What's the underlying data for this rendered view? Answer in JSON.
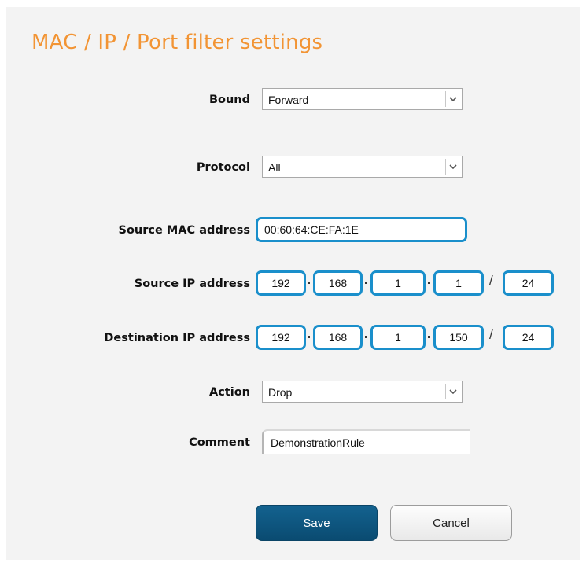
{
  "page": {
    "title": "MAC / IP / Port filter settings"
  },
  "form": {
    "bound": {
      "label": "Bound",
      "value": "Forward"
    },
    "protocol": {
      "label": "Protocol",
      "value": "All"
    },
    "source_mac": {
      "label": "Source MAC address",
      "value": "00:60:64:CE:FA:1E"
    },
    "source_ip": {
      "label": "Source IP address",
      "octets": [
        "192",
        "168",
        "1",
        "1"
      ],
      "mask": "24"
    },
    "destination_ip": {
      "label": "Destination IP address",
      "octets": [
        "192",
        "168",
        "1",
        "150"
      ],
      "mask": "24"
    },
    "action": {
      "label": "Action",
      "value": "Drop"
    },
    "comment": {
      "label": "Comment",
      "value": "DemonstrationRule"
    }
  },
  "buttons": {
    "save_label": "Save",
    "cancel_label": "Cancel"
  },
  "separators": {
    "slash": "/"
  },
  "colors": {
    "title": "#f29434",
    "field_border": "#1a8fcb",
    "save_button": "#0d5580",
    "panel_background": "#f3f3f3"
  },
  "icons": {
    "dropdown": "chevron-down-icon"
  }
}
